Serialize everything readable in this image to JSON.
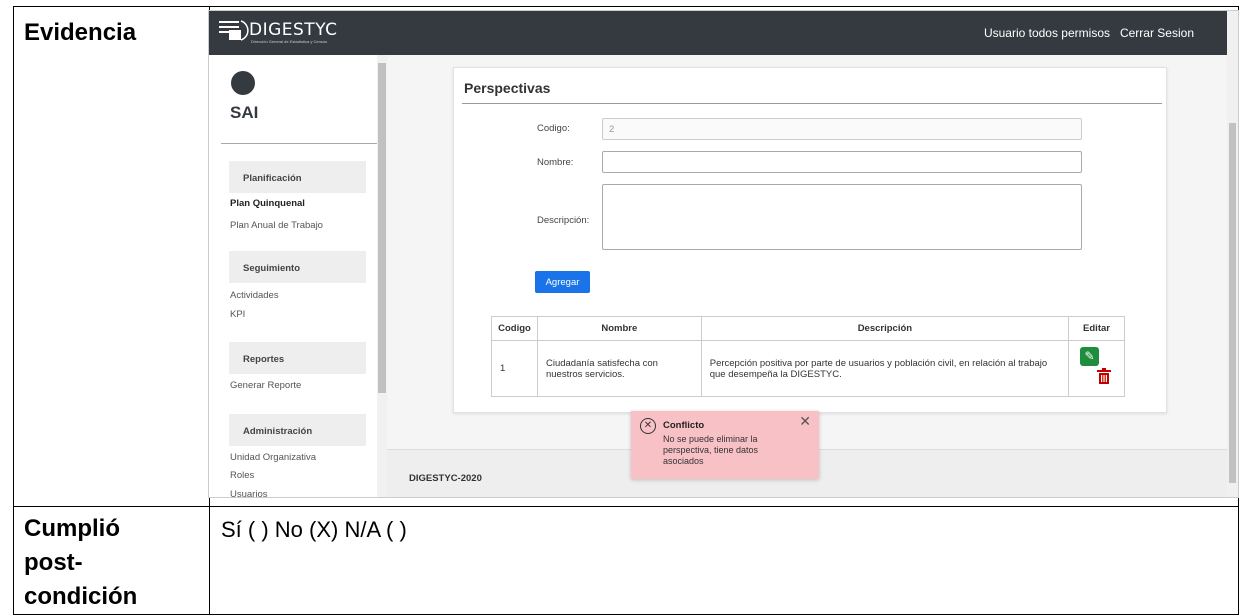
{
  "doc": {
    "evidence_label": "Evidencia",
    "post_label_1": "Cumplió",
    "post_label_2": "post-",
    "post_label_3": "condición",
    "post_value": "Sí ( )  No (X) N/A ( )"
  },
  "app": {
    "logo_text": "DIGESTYC",
    "logo_subtext": "Dirección General de Estadística y Censos",
    "user_link": "Usuario todos permisos",
    "logout_link": "Cerrar Sesion",
    "brand": "SAI"
  },
  "sidebar": {
    "sec1": "Planificación",
    "link_plan_quinquenal": "Plan Quinquenal",
    "link_plan_anual": "Plan Anual de Trabajo",
    "sec2": "Seguimiento",
    "link_actividades": "Actividades",
    "link_kpi": "KPI",
    "sec3": "Reportes",
    "link_generar_reporte": "Generar Reporte",
    "sec4": "Administración",
    "link_unidad": "Unidad Organizativa",
    "link_roles": "Roles",
    "link_usuarios": "Usuarios"
  },
  "form": {
    "title": "Perspectivas",
    "codigo_label": "Codigo:",
    "codigo_value": "2",
    "nombre_label": "Nombre:",
    "nombre_value": "",
    "descripcion_label": "Descripción:",
    "descripcion_value": "",
    "add_button": "Agregar"
  },
  "table": {
    "headers": [
      "Codigo",
      "Nombre",
      "Descripción",
      "Editar"
    ],
    "rows": [
      {
        "codigo": "1",
        "nombre": "Ciudadanía satisfecha con nuestros servicios.",
        "descripcion": "Percepción positiva por parte de usuarios y población civil, en relación al trabajo que desempeña la DIGESTYC."
      }
    ]
  },
  "toast": {
    "title": "Conflicto",
    "message": "No se puede eliminar la perspectiva, tiene datos asociados"
  },
  "footer": {
    "text": "DIGESTYC-2020"
  }
}
